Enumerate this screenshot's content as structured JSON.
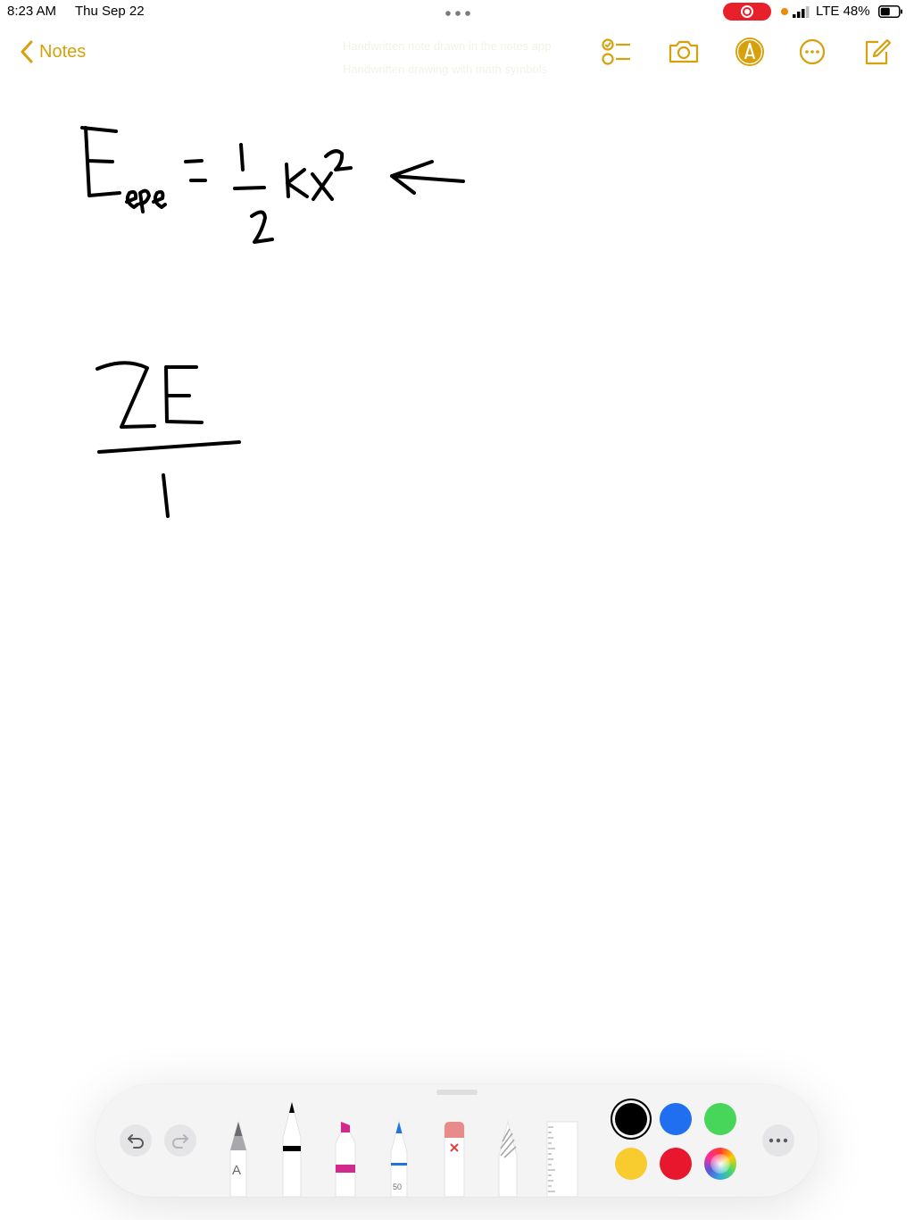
{
  "status_bar": {
    "time": "8:23 AM",
    "date": "Thu Sep 22",
    "network": "LTE 48%",
    "recording_color": "#e8202a",
    "mic_indicator_color": "#f08a00"
  },
  "nav": {
    "back_label": "Notes",
    "accent_color": "#d6a10c",
    "icons": [
      "checklist-icon",
      "camera-icon",
      "markup-icon",
      "more-icon",
      "compose-icon"
    ]
  },
  "ghost_text": {
    "line1": "Handwritten note drawn in the notes app",
    "line2": "Handwritten drawing with math symbols"
  },
  "toolbar": {
    "pencil_letter": "A",
    "marker_size": "50",
    "colors": [
      "#000000",
      "#1f6ff0",
      "#48d65a",
      "#f8cc2e",
      "#e8172d"
    ],
    "selected_color": "#000000"
  }
}
